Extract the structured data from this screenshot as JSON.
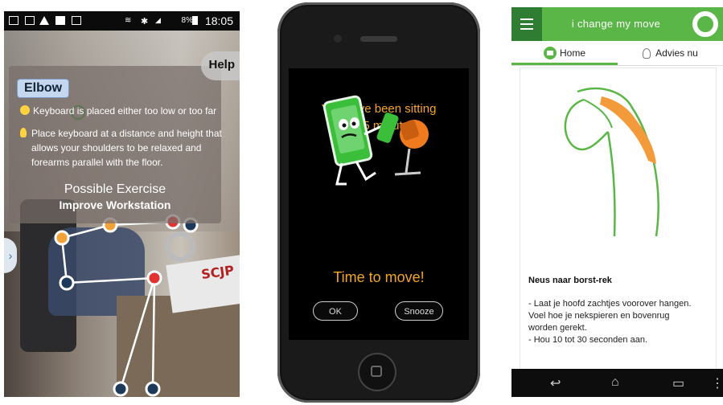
{
  "panel1": {
    "status": {
      "time": "18:05",
      "battery": "8%"
    },
    "help_label": "Help",
    "body_part": "Elbow",
    "problem": "Keyboard is placed either too low or too far",
    "advice_lines": [
      "Place keyboard at a distance and height that",
      "allows your shoulders to be relaxed and",
      "forearms parallel with the floor."
    ],
    "exercise_heading": "Possible Exercise",
    "exercise_name": "Improve Workstation",
    "book_text": "SCJP",
    "side_tab_icon": "chevron-right-icon"
  },
  "panel2": {
    "message_lines": [
      "You have been sitting",
      "for 45 minutes."
    ],
    "call_to_action": "Time to move!",
    "ok_label": "OK",
    "snooze_label": "Snooze",
    "accent": "#f4a623"
  },
  "panel3": {
    "app_title": "i change my move",
    "tabs": [
      {
        "label": "Home",
        "icon": "home-icon"
      },
      {
        "label": "Advies nu",
        "icon": "lightbulb-icon"
      }
    ],
    "exercise_title": "Neus naar borst-rek",
    "exercise_body": [
      "- Laat je hoofd zachtjes voorover hangen.",
      "Voel hoe je nekspieren en bovenrug",
      "worden gerekt.",
      "- Hou 10 tot 30 seconden aan."
    ],
    "nav_icons": [
      "back-icon",
      "home-icon",
      "recent-apps-icon",
      "more-icon"
    ],
    "brand_color": "#5ab646"
  }
}
